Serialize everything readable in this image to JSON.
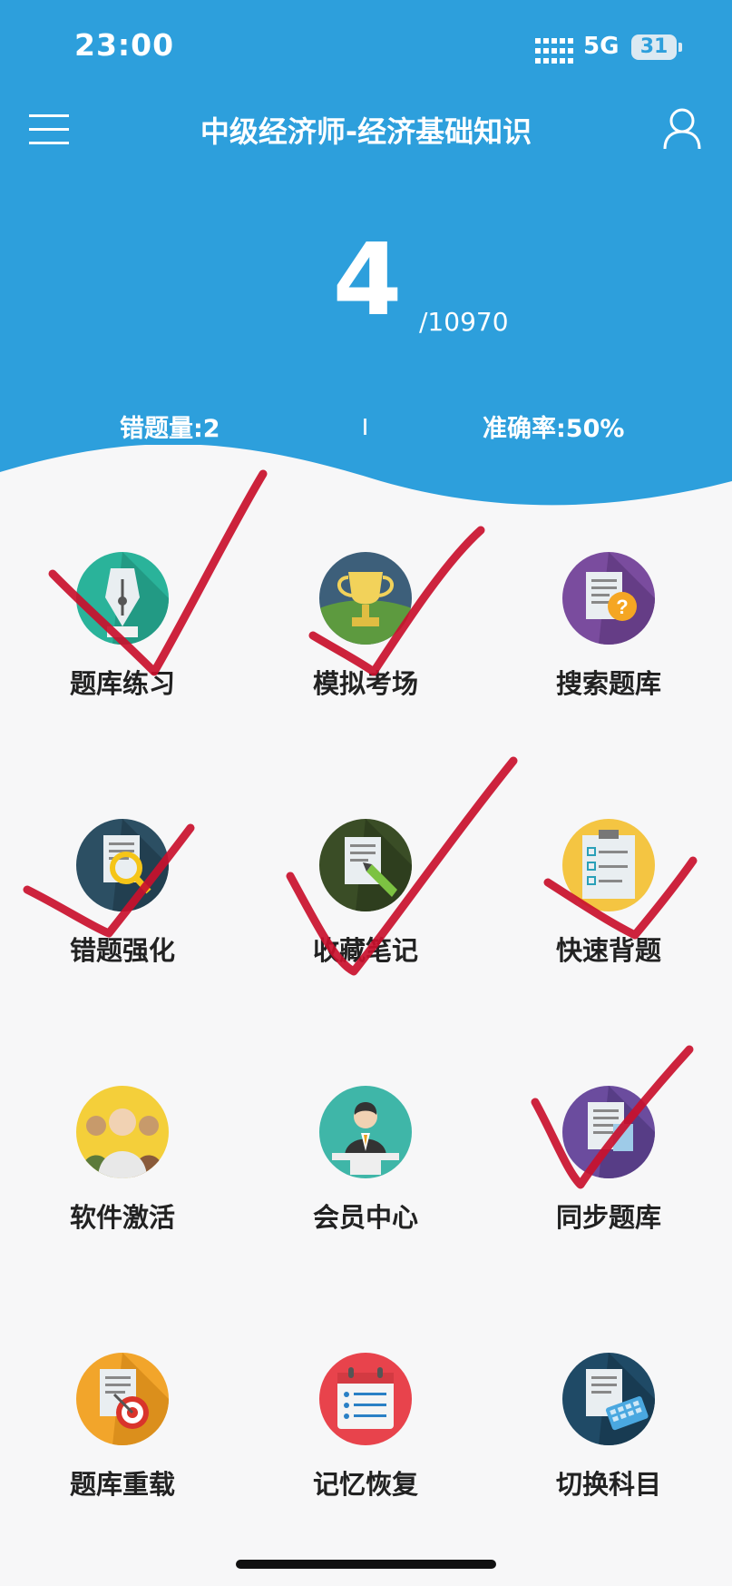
{
  "status_bar": {
    "time": "23:00",
    "network": "5G",
    "battery": "31"
  },
  "header": {
    "title": "中级经济师-经济基础知识",
    "count": "4",
    "total": "/10970",
    "wrong_label": "错题量:2",
    "accuracy_label": "准确率:50%",
    "divider": "|"
  },
  "grid": [
    {
      "label": "题库练习",
      "icon": "pen-nib-icon"
    },
    {
      "label": "模拟考场",
      "icon": "trophy-icon"
    },
    {
      "label": "搜索题库",
      "icon": "search-question-icon"
    },
    {
      "label": "错题强化",
      "icon": "magnifier-document-icon"
    },
    {
      "label": "收藏笔记",
      "icon": "note-pen-icon"
    },
    {
      "label": "快速背题",
      "icon": "checklist-clipboard-icon"
    },
    {
      "label": "软件激活",
      "icon": "people-group-icon"
    },
    {
      "label": "会员中心",
      "icon": "member-avatar-icon"
    },
    {
      "label": "同步题库",
      "icon": "sync-document-icon"
    },
    {
      "label": "题库重载",
      "icon": "target-document-icon"
    },
    {
      "label": "记忆恢复",
      "icon": "calendar-list-icon"
    },
    {
      "label": "切换科目",
      "icon": "keyboard-document-icon"
    }
  ],
  "colors": {
    "header_blue": "#2d9fdc",
    "check_red": "#c9102c",
    "page_bg": "#f7f7f8"
  }
}
